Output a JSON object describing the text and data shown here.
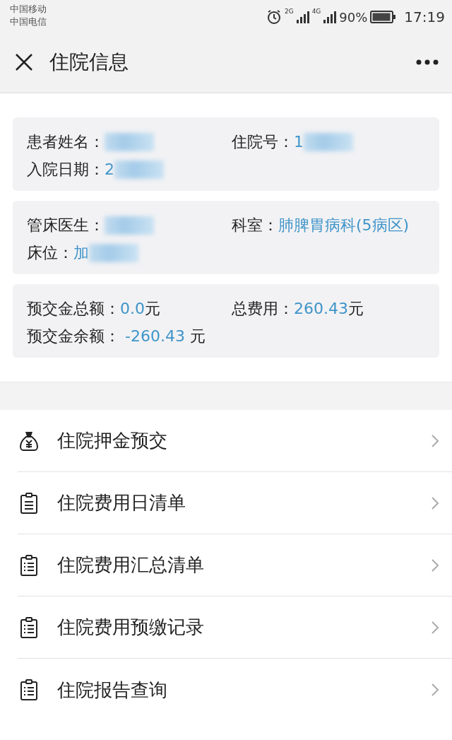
{
  "status_bar": {
    "carriers": [
      "中国移动",
      "中国电信"
    ],
    "network_1": "2G",
    "network_2": "4G",
    "battery": "90%",
    "time": "17:19"
  },
  "header": {
    "title": "住院信息"
  },
  "info_cards": [
    {
      "fields": [
        {
          "label": "患者姓名：",
          "redacted": true
        },
        {
          "label": "住院号：",
          "value": "1",
          "redacted": true
        },
        {
          "label": "入院日期：",
          "value": "2",
          "redacted": true
        }
      ]
    },
    {
      "fields": [
        {
          "label": "管床医生：",
          "redacted": true
        },
        {
          "label": "科室：",
          "value": "肺脾胃病科(5病区)",
          "redacted": false
        },
        {
          "label": "床位：",
          "value": "加",
          "redacted": true
        }
      ]
    },
    {
      "fields": [
        {
          "label": "预交金总额：",
          "value": "0.0",
          "unit": "元",
          "redacted": false
        },
        {
          "label": "总费用：",
          "value": "260.43",
          "unit": "元",
          "redacted": false
        },
        {
          "label": "预交金余额：",
          "value": " -260.43",
          "unit": " 元",
          "redacted": false
        }
      ]
    }
  ],
  "menu": [
    {
      "label": "住院押金预交",
      "kind": "deposit"
    },
    {
      "label": "住院费用日清单",
      "kind": "daily"
    },
    {
      "label": "住院费用汇总清单",
      "kind": "list"
    },
    {
      "label": "住院费用预缴记录",
      "kind": "list"
    },
    {
      "label": "住院报告查询",
      "kind": "list"
    }
  ]
}
